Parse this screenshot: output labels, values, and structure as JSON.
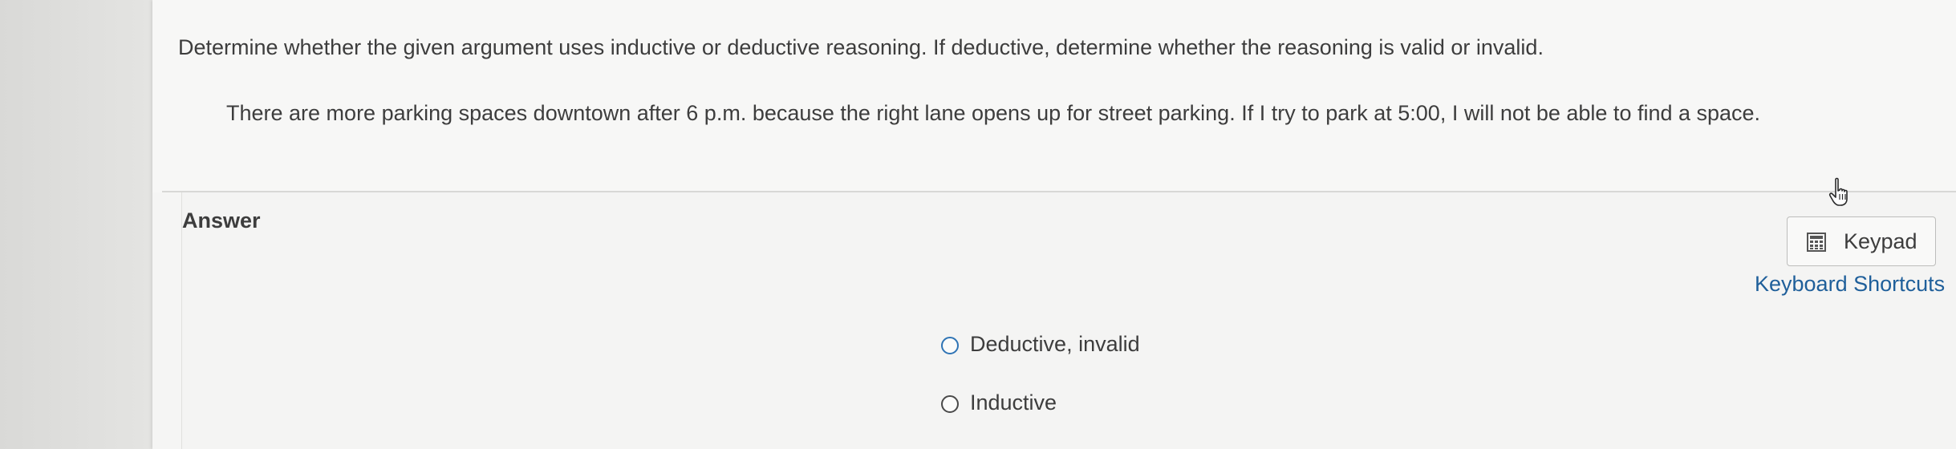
{
  "question": {
    "prompt": "Determine whether the given argument uses inductive or deductive reasoning. If deductive, determine whether the reasoning is valid or invalid.",
    "statement": "There are more parking spaces downtown after 6 p.m. because the right lane opens up for street parking. If I try to park at 5:00, I will not be able to find a space."
  },
  "answer": {
    "label": "Answer",
    "options": [
      {
        "label": "Deductive, invalid"
      },
      {
        "label": "Inductive"
      }
    ]
  },
  "tools": {
    "keypad_label": "Keypad",
    "keypad_icon": "calculator-icon",
    "shortcuts_label": "Keyboard Shortcuts",
    "pointer_icon": "hand-pointer-icon"
  },
  "colors": {
    "link": "#1f5f9a",
    "radio_focus": "#2f74b5"
  }
}
